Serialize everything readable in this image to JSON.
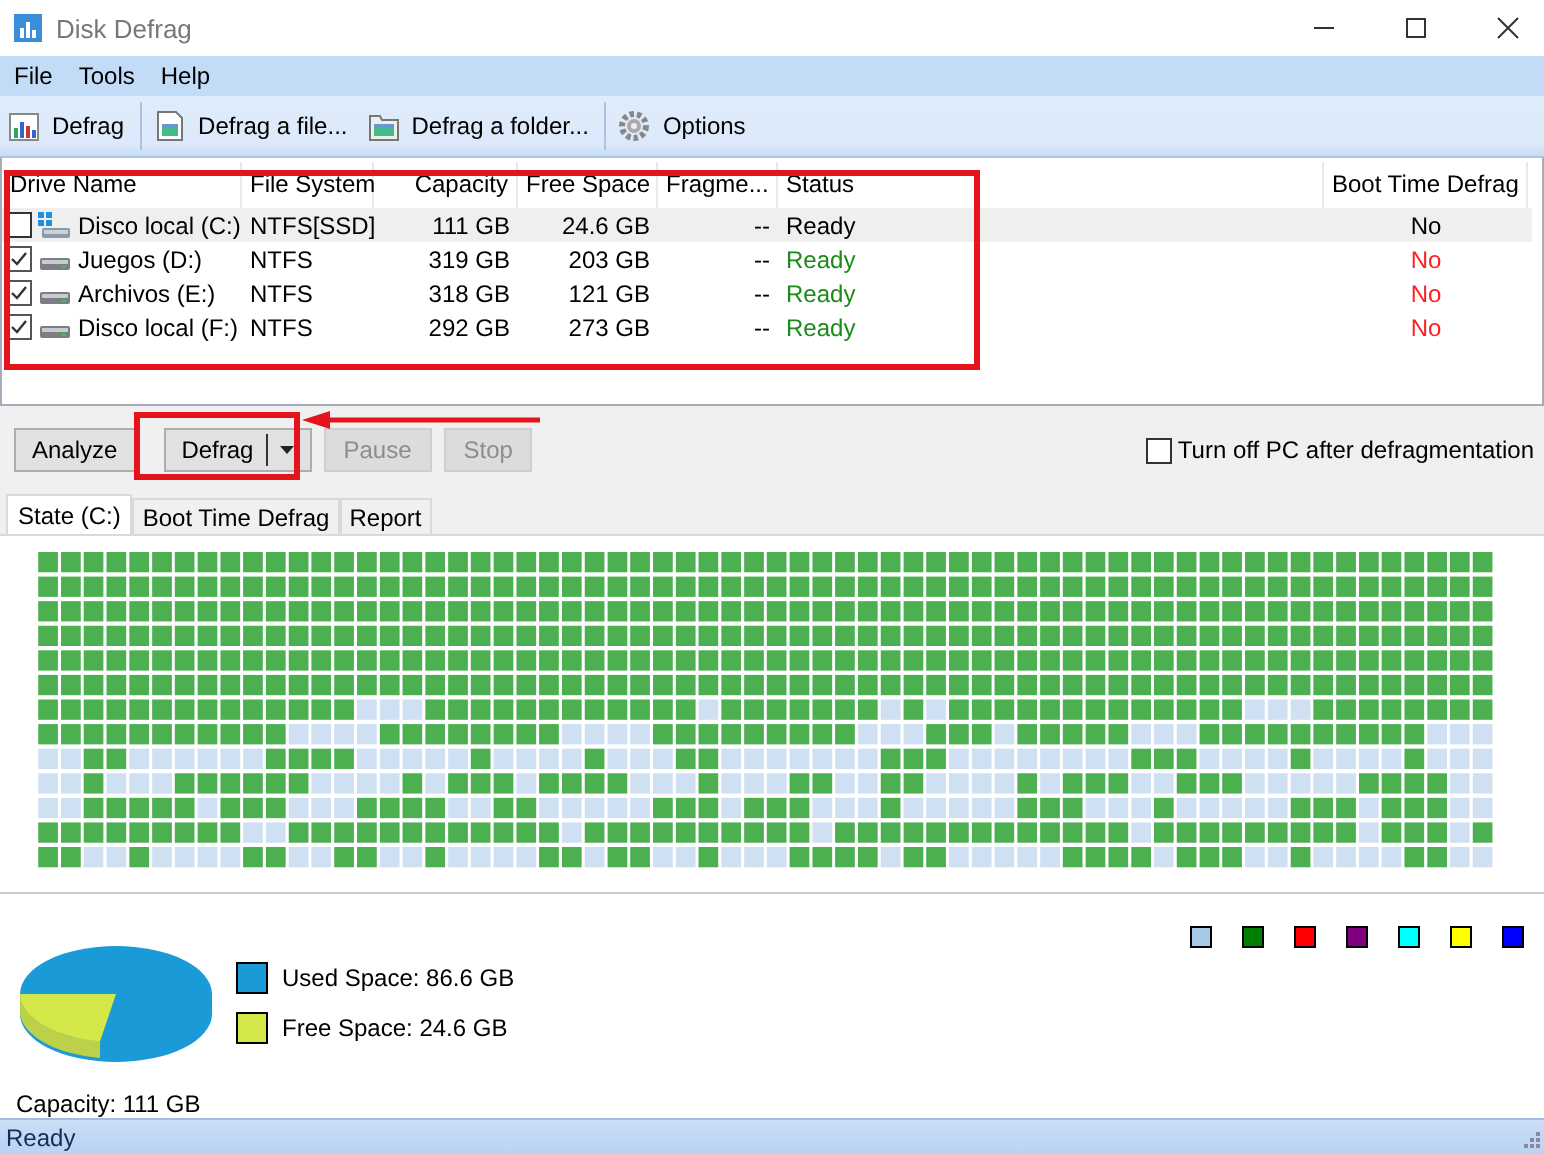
{
  "window": {
    "title": "Disk Defrag"
  },
  "menu": [
    "File",
    "Tools",
    "Help"
  ],
  "toolbar": [
    {
      "label": "Defrag",
      "kind": "defrag"
    },
    {
      "label": "Defrag a file...",
      "kind": "file"
    },
    {
      "label": "Defrag a folder...",
      "kind": "folder"
    },
    {
      "label": "Options",
      "kind": "options"
    }
  ],
  "table": {
    "columns": [
      "Drive Name",
      "File System",
      "Capacity",
      "Free Space",
      "Fragme...",
      "Status",
      "Boot Time Defrag"
    ],
    "rows": [
      {
        "checked": false,
        "selected": true,
        "kind": "system",
        "name": "Disco local (C:)",
        "file_system": "NTFS[SSD]",
        "capacity": "111 GB",
        "free_space": "24.6 GB",
        "fragmentation": "--",
        "status": "Ready",
        "boot_time_defrag": "No"
      },
      {
        "checked": true,
        "selected": false,
        "kind": "drive",
        "name": "Juegos (D:)",
        "file_system": "NTFS",
        "capacity": "319 GB",
        "free_space": "203 GB",
        "fragmentation": "--",
        "status": "Ready",
        "boot_time_defrag": "No"
      },
      {
        "checked": true,
        "selected": false,
        "kind": "drive",
        "name": "Archivos (E:)",
        "file_system": "NTFS",
        "capacity": "318 GB",
        "free_space": "121 GB",
        "fragmentation": "--",
        "status": "Ready",
        "boot_time_defrag": "No"
      },
      {
        "checked": true,
        "selected": false,
        "kind": "drive",
        "name": "Disco local (F:)",
        "file_system": "NTFS",
        "capacity": "292 GB",
        "free_space": "273 GB",
        "fragmentation": "--",
        "status": "Ready",
        "boot_time_defrag": "No"
      }
    ]
  },
  "actions": [
    {
      "label": "Analyze",
      "kind": "plain",
      "disabled": false
    },
    {
      "label": "Defrag",
      "kind": "split",
      "disabled": false
    },
    {
      "label": "Pause",
      "kind": "plain",
      "disabled": true
    },
    {
      "label": "Stop",
      "kind": "plain",
      "disabled": true
    }
  ],
  "shutdown_option": {
    "label": "Turn off PC after defragmentation",
    "checked": false
  },
  "tabs": [
    {
      "label": "State (C:)",
      "selected": true
    },
    {
      "label": "Boot Time Defrag",
      "selected": false
    },
    {
      "label": "Report",
      "selected": false
    }
  ],
  "cluster_legend": [
    {
      "color": "#a8c8e8"
    },
    {
      "color": "#008000"
    },
    {
      "color": "#ff0000"
    },
    {
      "color": "#800080"
    },
    {
      "color": "#00ffff"
    },
    {
      "color": "#ffff00"
    },
    {
      "color": "#0000ff"
    }
  ],
  "space": [
    {
      "label": "Used Space: 86.6 GB",
      "color": "#1a9ad6"
    },
    {
      "label": "Free Space: 24.6 GB",
      "color": "#d4e84a"
    }
  ],
  "capacity": "Capacity: 111 GB",
  "status_bar": "Ready"
}
